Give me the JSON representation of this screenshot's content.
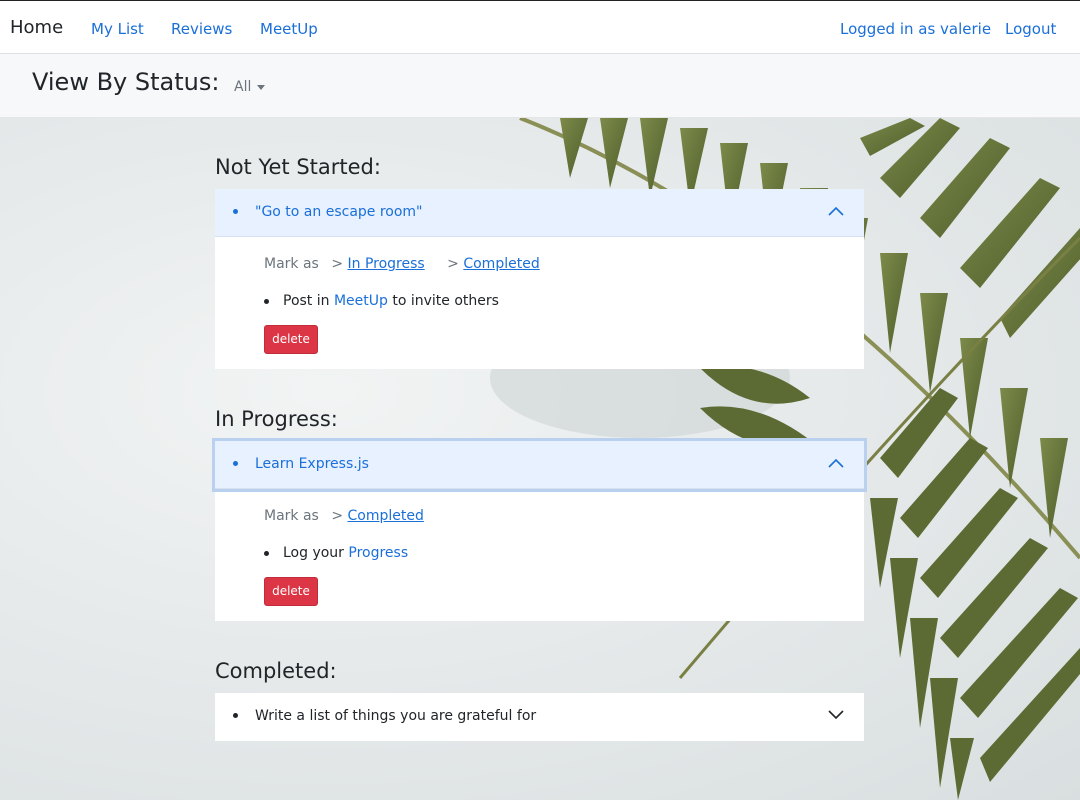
{
  "nav": {
    "brand": "Home",
    "links": [
      "My List",
      "Reviews",
      "MeetUp"
    ],
    "user": "Logged in as valerie",
    "logout": "Logout"
  },
  "status": {
    "title": "View By Status:",
    "selected": "All"
  },
  "sections": {
    "not_started": {
      "title": "Not Yet Started:",
      "item": "\"Go to an escape room\"",
      "mark_as": "Mark as",
      "arrow": ">",
      "action1": "In Progress",
      "action2": "Completed",
      "hint_prefix": "Post in",
      "hint_link": "MeetUp",
      "hint_suffix": "to invite others",
      "delete": "delete"
    },
    "in_progress": {
      "title": "In Progress:",
      "item": "Learn Express.js",
      "mark_as": "Mark as",
      "arrow": ">",
      "action1": "Completed",
      "hint_prefix": "Log your",
      "hint_link": "Progress",
      "delete": "delete"
    },
    "completed": {
      "title": "Completed:",
      "item": "Write a list of things you are grateful for"
    }
  },
  "colors": {
    "link": "#1a6fd8",
    "delete": "#dc3545",
    "header_bg": "#e7f1ff"
  }
}
